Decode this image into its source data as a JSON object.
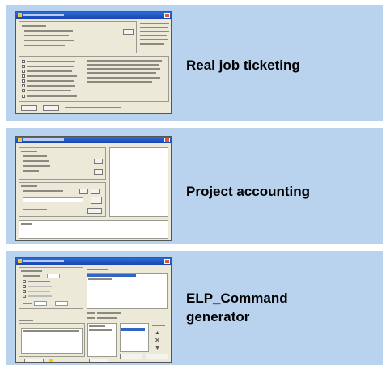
{
  "slides": [
    {
      "label": "Real job ticketing"
    },
    {
      "label": "Project accounting"
    },
    {
      "label_line1": "ELP_Command",
      "label_line2": "generator"
    }
  ],
  "colors": {
    "panel_bg": "#b9d3ee",
    "window_bg": "#ece9d8",
    "titlebar": "#2e6ad6"
  }
}
